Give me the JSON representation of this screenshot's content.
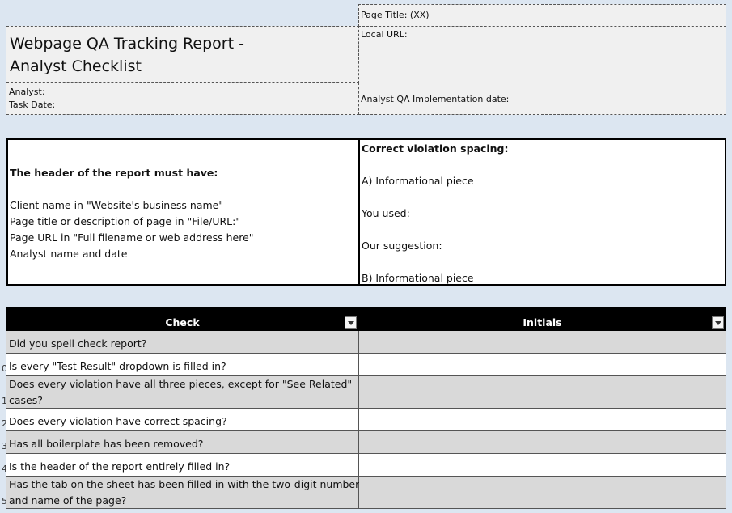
{
  "header": {
    "title_line1": "Webpage QA Tracking Report -",
    "title_line2": "Analyst Checklist",
    "analyst_label": "Analyst:",
    "task_date_label": "Task Date:",
    "page_title_label": "Page Title: (XX)",
    "local_url_label": "Local URL:",
    "implementation_date_label": "Analyst QA Implementation date:"
  },
  "instructions": {
    "heading": "The header of the report must have:",
    "items": [
      "Client name in \"Website's business name\"",
      "Page title or description of page in \"File/URL:\"",
      "Page URL in \"Full filename or web address here\"",
      "Analyst name and date"
    ]
  },
  "spacing": {
    "heading": "Correct violation spacing:",
    "line_a": "A) Informational piece",
    "you_used": "You used:",
    "our_suggestion": "Our suggestion:",
    "line_b": "B) Informational piece"
  },
  "table": {
    "columns": [
      "Check",
      "Initials"
    ],
    "rows": [
      {
        "num": "",
        "check_line1": "Did you spell check report?",
        "check_line2": "",
        "initials": ""
      },
      {
        "num": "0",
        "check_line1": "Is every \"Test Result\" dropdown is filled in?",
        "check_line2": "",
        "initials": ""
      },
      {
        "num": "1",
        "check_line1": "Does every violation have all three pieces, except for \"See Related\"",
        "check_line2": "cases?",
        "initials": ""
      },
      {
        "num": "2",
        "check_line1": "Does every violation have correct spacing?",
        "check_line2": "",
        "initials": ""
      },
      {
        "num": "3",
        "check_line1": "Has all boilerplate has been removed?",
        "check_line2": "",
        "initials": ""
      },
      {
        "num": "4",
        "check_line1": "Is the header of the report entirely filled in?",
        "check_line2": "",
        "initials": ""
      },
      {
        "num": "5",
        "check_line1": "Has the tab on the sheet has been filled in with the two-digit number",
        "check_line2": "and name of the page?",
        "initials": ""
      }
    ]
  },
  "colors": {
    "background": "#dce6f1",
    "table_header": "#000000",
    "row_shaded": "#d9d9d9"
  }
}
